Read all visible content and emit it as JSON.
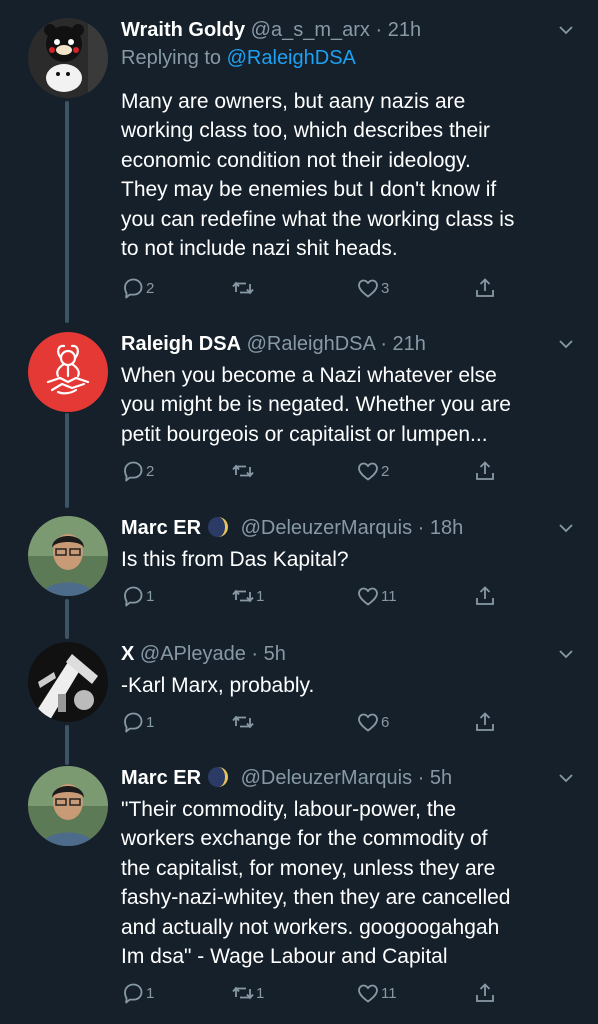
{
  "tweets": [
    {
      "name": "Wraith Goldy",
      "handle": "@a_s_m_arx",
      "dot": "·",
      "time": "21h",
      "reply_prefix": "Replying to",
      "reply_mention": "@RaleighDSA",
      "text": "Many are owners, but aany nazis are\nworking class too, which describes their\neconomic condition not their ideology.\nThey may be enemies but I don't know if\nyou can redefine what the working class is\nto not include nazi shit heads.",
      "replies": "2",
      "retweets": "",
      "likes": "3"
    },
    {
      "name": "Raleigh DSA",
      "handle": "@RaleighDSA",
      "dot": "·",
      "time": "21h",
      "text": "When you become a Nazi whatever else\nyou might be is negated.  Whether you are\npetit bourgeois or capitalist or lumpen...",
      "replies": "2",
      "retweets": "",
      "likes": "2"
    },
    {
      "name": "Marc ER",
      "handle": "@DeleuzerMarquis",
      "dot": "·",
      "time": "18h",
      "text": "Is this from Das Kapital?",
      "replies": "1",
      "retweets": "1",
      "likes": "11"
    },
    {
      "name": "X",
      "handle": "@APleyade",
      "dot": "·",
      "time": "5h",
      "text": "-Karl Marx, probably.",
      "replies": "1",
      "retweets": "",
      "likes": "6"
    },
    {
      "name": "Marc ER",
      "handle": "@DeleuzerMarquis",
      "dot": "·",
      "time": "5h",
      "text": "\"Their commodity, labour-power, the\nworkers exchange for the commodity of\nthe capitalist, for money, unless they are\nfashy-nazi-whitey, then they are cancelled\nand actually not workers. googoogahgah\nIm dsa\" - Wage Labour and Capital",
      "replies": "1",
      "retweets": "1",
      "likes": "11"
    }
  ],
  "colors": {
    "background": "#15202b",
    "secondary_text": "#8899a6",
    "link": "#1da1f2",
    "thread_line": "#3d5466",
    "dsa_red": "#e53935"
  },
  "icons": [
    "reply-icon",
    "retweet-icon",
    "like-icon",
    "share-icon",
    "chevron-down-icon",
    "moon-badge-icon"
  ]
}
